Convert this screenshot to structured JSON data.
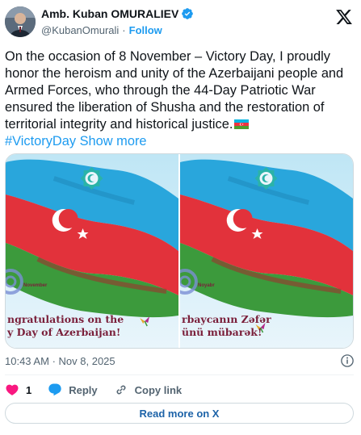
{
  "author": {
    "name": "Amb. Kuban OMURALIEV",
    "handle": "@KubanOmurali",
    "separator": "·",
    "follow_label": "Follow"
  },
  "tweet": {
    "body": "On the occasion of 8 November – Victory Day, I proudly honor the heroism and unity of the Azerbaijani people and Armed Forces, who through the 44-Day Patriotic War ensured the liberation of Shusha and the restoration of territorial integrity and historical justice.",
    "hashtag": "#VictoryDay",
    "show_more": "Show more"
  },
  "media": [
    {
      "small_label": "November",
      "caption_line1": "ngratulations on the",
      "caption_line2": "y Day of Azerbaijan!"
    },
    {
      "small_label": "Noyabr",
      "caption_line1": "rbaycanın Zəfər",
      "caption_line2": "ünü mübarək!"
    }
  ],
  "meta": {
    "time": "10:43 AM",
    "separator": "·",
    "date": "Nov 8, 2025"
  },
  "actions": {
    "likes": "1",
    "reply": "Reply",
    "copy_link": "Copy link"
  },
  "read_more": "Read more on X",
  "colors": {
    "accent": "#1d9bf0",
    "like": "#f91880",
    "flag_blue": "#00b5e2",
    "flag_red": "#ef3340",
    "flag_green": "#509e2f"
  }
}
